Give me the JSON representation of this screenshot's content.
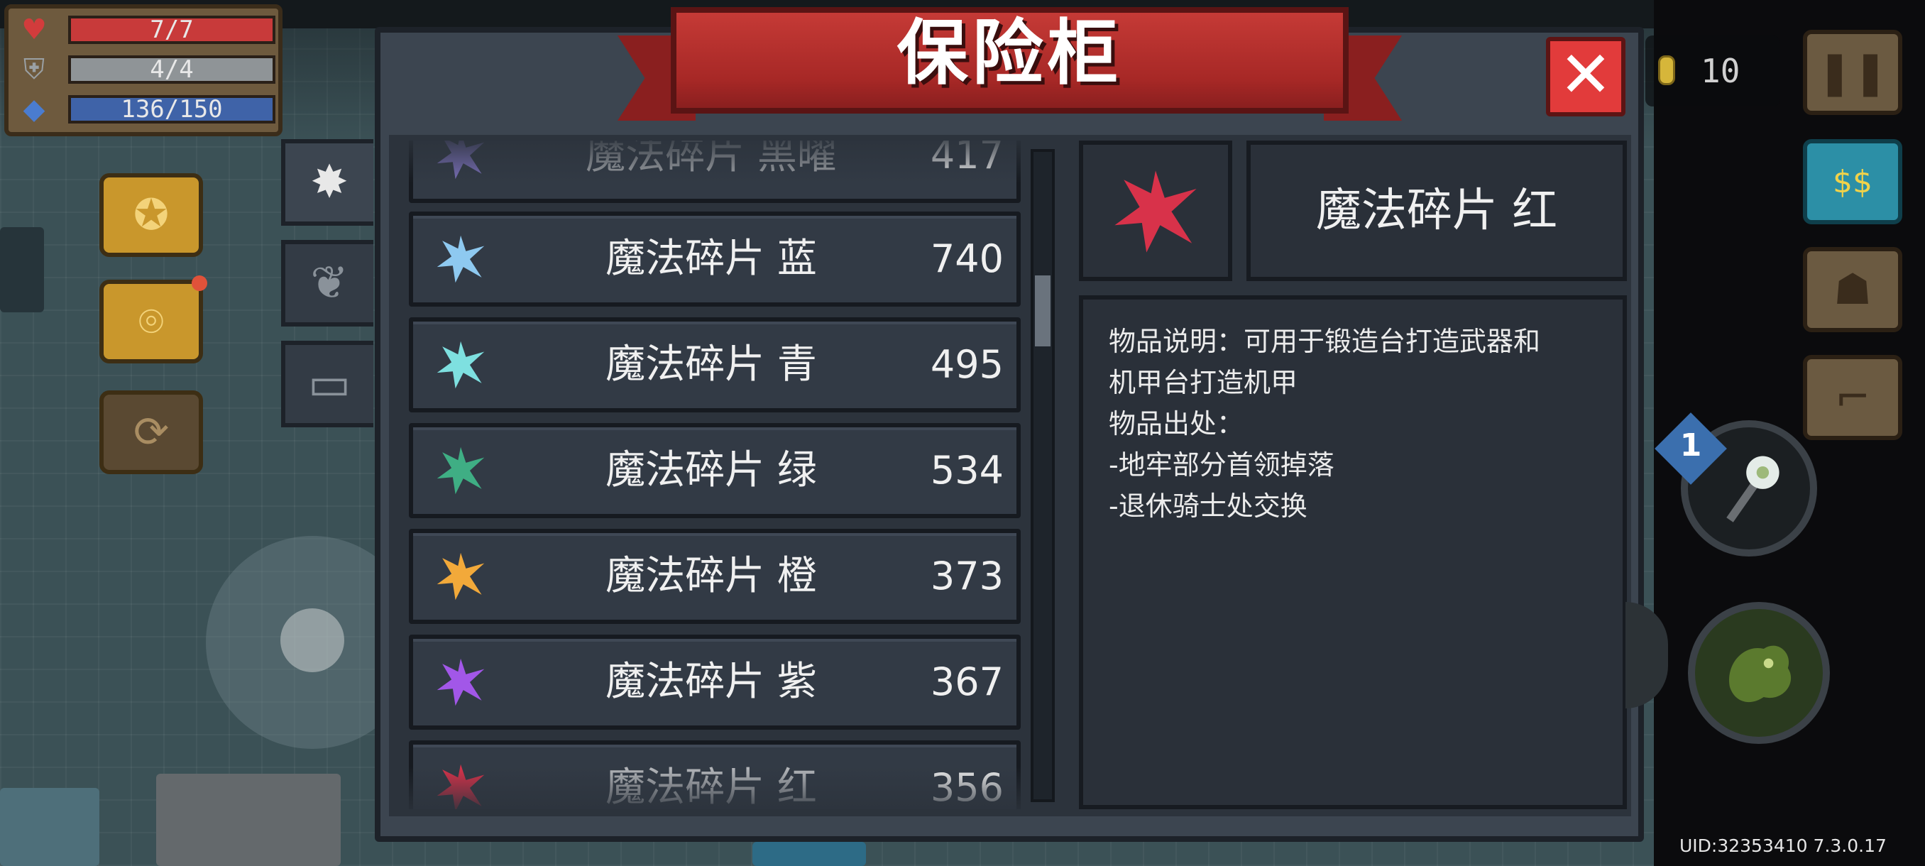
{
  "hud": {
    "hp": "7/7",
    "armor": "4/4",
    "energy": "136/150",
    "coins": "10",
    "colors": {
      "hp": "#c83a3a",
      "armor": "#8f9497",
      "energy": "#3f63a8"
    }
  },
  "vault": {
    "title": "保险柜",
    "close_label": "✕",
    "tabs": [
      {
        "icon": "sparkle-icon",
        "glyph": "✸",
        "active": true
      },
      {
        "icon": "plant-icon",
        "glyph": "❦",
        "active": false
      },
      {
        "icon": "ticket-icon",
        "glyph": "▭",
        "active": false
      }
    ],
    "items": [
      {
        "name": "魔法碎片 黑曜",
        "count": "417",
        "color": "#7a6fb8"
      },
      {
        "name": "魔法碎片 蓝",
        "count": "740",
        "color": "#8ec9f0"
      },
      {
        "name": "魔法碎片 青",
        "count": "495",
        "color": "#7ee0e0"
      },
      {
        "name": "魔法碎片 绿",
        "count": "534",
        "color": "#3fae84"
      },
      {
        "name": "魔法碎片 橙",
        "count": "373",
        "color": "#f2a93a"
      },
      {
        "name": "魔法碎片 紫",
        "count": "367",
        "color": "#a257e8"
      },
      {
        "name": "魔法碎片 红",
        "count": "356",
        "color": "#d8324a"
      }
    ],
    "selected": {
      "name": "魔法碎片  红",
      "color": "#d8324a",
      "description_lines": [
        "物品说明：可用于锻造台打造武器和",
        "机甲台打造机甲",
        "物品出处：",
        "-地牢部分首领掉落",
        "-退休骑士处交换"
      ]
    }
  },
  "weapon": {
    "level": "1"
  },
  "footer": {
    "uid": "UID:32353410 7.3.0.17"
  }
}
